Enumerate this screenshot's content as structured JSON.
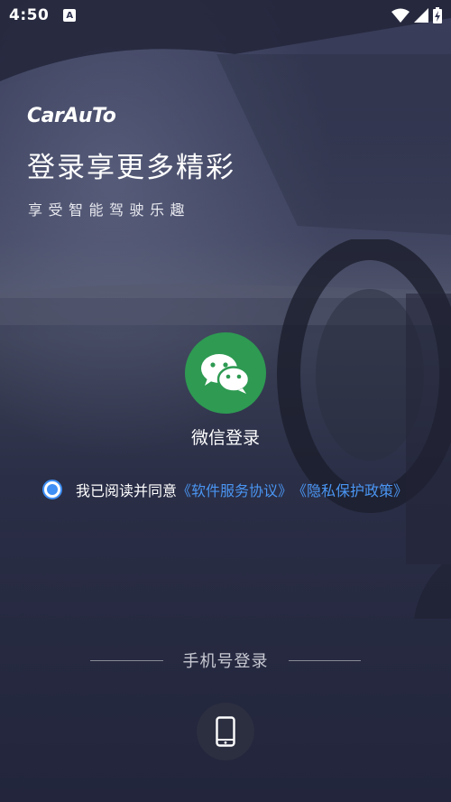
{
  "status_bar": {
    "time": "4:50",
    "notification_badge": "A",
    "icons": [
      "wifi-icon",
      "signal-icon",
      "battery-charging-icon"
    ]
  },
  "brand": {
    "logo_text": "CarAuTo"
  },
  "hero": {
    "title": "登录享更多精彩",
    "subtitle": "享受智能驾驶乐趣"
  },
  "wechat_login": {
    "label": "微信登录",
    "color": "#2e9a52",
    "icon": "wechat-icon"
  },
  "agreement": {
    "checked": true,
    "prefix": "我已阅读并同意",
    "software_agreement": "《软件服务协议》",
    "privacy_policy": "《隐私保护政策》",
    "link_color": "#4a95f2"
  },
  "alt_login": {
    "label": "手机号登录",
    "icon": "phone-icon"
  }
}
